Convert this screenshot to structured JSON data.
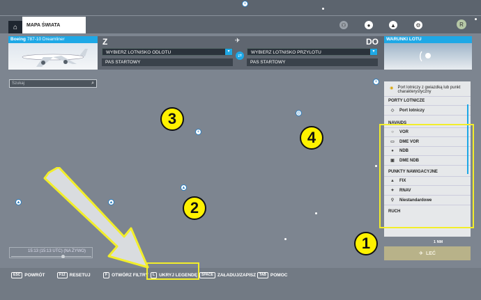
{
  "topbar": {
    "world_map_tab": "MAPA ŚWIATA",
    "avatar_initial": "R"
  },
  "header": {
    "aircraft_name_bold": "Boeing",
    "aircraft_name_rest": " 787-10 Dreamliner",
    "from_letter": "Z",
    "to_letter": "DO",
    "departure_select": "WYBIERZ LOTNISKO ODLOTU",
    "arrival_select": "WYBIERZ LOTNISKO PRZYLOTU",
    "departure_runway": "PAS STARTOWY",
    "arrival_runway": "PAS STARTOWY",
    "weather_label": "WARUNKI LOTU"
  },
  "search": {
    "placeholder": "Szukaj"
  },
  "legend": {
    "top_item": "Port lotniczy z gwiazdką lub punkt charakterystyczny",
    "airports_header": "PORTY LOTNICZE",
    "airport_item": "Port lotniczy",
    "navaids_header": "NAVAIDS",
    "navaids": [
      "VOR",
      "DME VOR",
      "NDB",
      "DME NDB"
    ],
    "navpoints_header": "PUNKTY NAWIGACYJNE",
    "navpoints": [
      "FIX",
      "RNAV",
      "Niestandardowe"
    ],
    "cut_item": "RUCH",
    "scale": "1 NM"
  },
  "fly_button": "LEĆ",
  "timeline": {
    "time_text": "15:13 (15:13 UTC) (NA ŻYWO)"
  },
  "bottombar": [
    {
      "key": "ESC",
      "label": "POWRÓT"
    },
    {
      "key": "F12",
      "label": "RESETUJ"
    },
    {
      "key": "F",
      "label": "OTWÓRZ FILTRY"
    },
    {
      "key": "L",
      "label": "UKRYJ LEGENDĘ"
    },
    {
      "key": "SPACE",
      "label": "ZAŁADUJ/ZAPISZ"
    },
    {
      "key": "TAB",
      "label": "POMOC"
    }
  ],
  "annotations": {
    "n1": "1",
    "n2": "2",
    "n3": "3",
    "n4": "4"
  },
  "colors": {
    "accent": "#1ea8e6",
    "highlight": "#f2ee2a",
    "map_bg": "#7d8590"
  }
}
